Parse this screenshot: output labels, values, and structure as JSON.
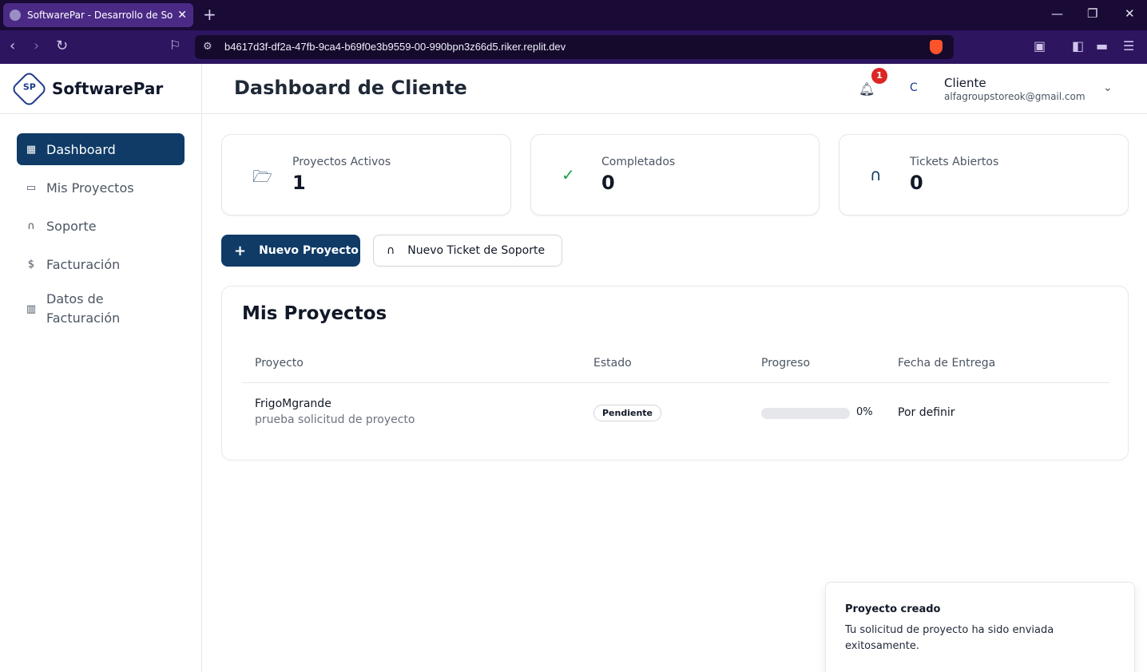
{
  "browser": {
    "tab_title": "SoftwarePar - Desarrollo de Softw",
    "url": "b4617d3f-df2a-47fb-9ca4-b69f0e3b9559-00-990bpn3z66d5.riker.replit.dev"
  },
  "sidebar": {
    "brand": "SoftwarePar",
    "logo_text": "SP",
    "items": [
      {
        "label": "Dashboard",
        "icon": "grid-icon",
        "active": true
      },
      {
        "label": "Mis Proyectos",
        "icon": "folder-icon",
        "active": false
      },
      {
        "label": "Soporte",
        "icon": "headset-icon",
        "active": false
      },
      {
        "label": "Facturación",
        "icon": "receipt-icon",
        "active": false
      },
      {
        "label": "Datos de Facturación",
        "icon": "building-icon",
        "active": false
      }
    ]
  },
  "header": {
    "title": "Dashboard de Cliente",
    "notification_count": "1",
    "user_initial": "C",
    "user_name": "Cliente",
    "user_email": "alfagroupstoreok@gmail.com"
  },
  "stats": [
    {
      "label": "Proyectos Activos",
      "value": "1",
      "icon": "folder-open-icon",
      "color": "#0f3b66"
    },
    {
      "label": "Completados",
      "value": "0",
      "icon": "check-circle-icon",
      "color": "#16a34a"
    },
    {
      "label": "Tickets Abiertos",
      "value": "0",
      "icon": "headset-icon",
      "color": "#0f3b66"
    }
  ],
  "actions": {
    "new_project": "Nuevo Proyecto",
    "new_ticket": "Nuevo Ticket de Soporte"
  },
  "projects": {
    "title": "Mis Proyectos",
    "columns": [
      "Proyecto",
      "Estado",
      "Progreso",
      "Fecha de Entrega"
    ],
    "rows": [
      {
        "name": "FrigoMgrande",
        "description": "prueba solicitud de proyecto",
        "status": "Pendiente",
        "progress": 0,
        "progress_label": "0%",
        "due": "Por definir"
      }
    ]
  },
  "toast": {
    "title": "Proyecto creado",
    "message": "Tu solicitud de proyecto ha sido enviada exitosamente."
  },
  "colors": {
    "primary": "#0f3b66",
    "badge": "#dc2626",
    "browser_tab": "#4b2a86",
    "browser_bar": "#2d1560"
  }
}
